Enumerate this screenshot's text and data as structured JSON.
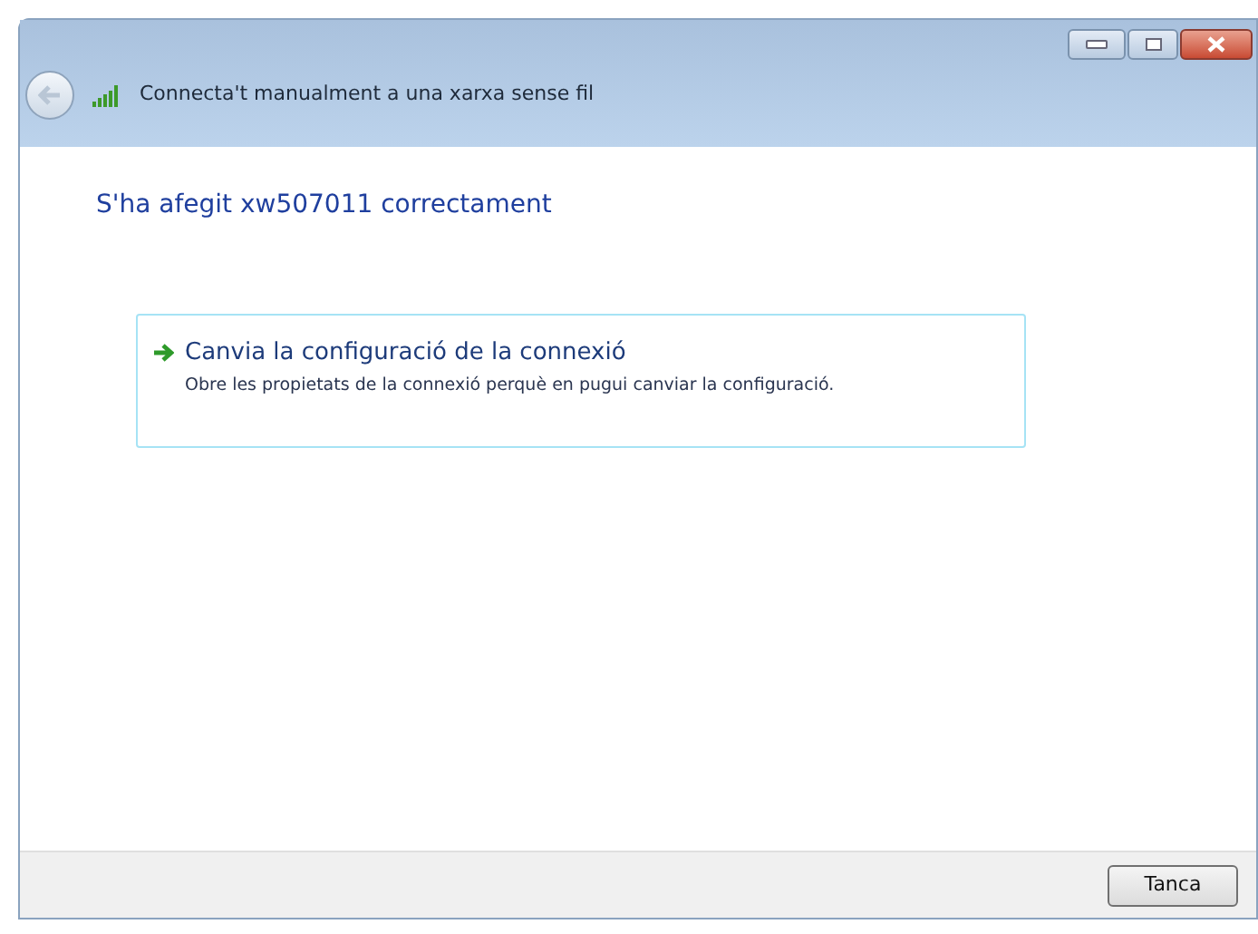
{
  "window": {
    "title": "Connecta't manualment a una xarxa sense fil"
  },
  "heading": "S'ha afegit xw507011 correctament",
  "option": {
    "title": "Canvia la configuració de la connexió",
    "description": "Obre les propietats de la connexió perquè en pugui canviar la configuració."
  },
  "buttons": [
    "Tanca"
  ]
}
